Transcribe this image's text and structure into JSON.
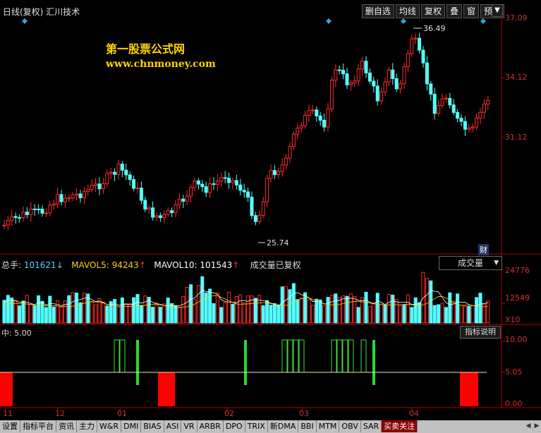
{
  "window": {
    "title": "日线(复权) 汇川技术"
  },
  "toolbar": {
    "buttons": [
      "删自选",
      "均线",
      "复权",
      "叠",
      "窗",
      "预测"
    ]
  },
  "price_axis": {
    "labels": [
      "37.09",
      "34.12",
      "31.12"
    ]
  },
  "annotations": {
    "high": "36.49",
    "low": "25.74",
    "badge": "财"
  },
  "watermark": {
    "line1": "第一股票公式网",
    "line2": "www.chnmoney.com"
  },
  "volume_header": {
    "total_label": "总手:",
    "total_value": "101621",
    "mavol5_label": "MAVOL5:",
    "mavol5_value": "94243",
    "mavol10_label": "MAVOL10:",
    "mavol10_value": "101543",
    "note": "成交量已复权",
    "dropdown": "成交量"
  },
  "volume_axis": {
    "labels": [
      "24776",
      "12549",
      "X10"
    ]
  },
  "indicator": {
    "header": "中: 5.00",
    "explain_button": "指标说明",
    "axis": [
      "10.00",
      "5.05",
      "0.00"
    ]
  },
  "date_axis": {
    "labels": [
      "11",
      "12",
      "01",
      "02",
      "03",
      "04"
    ]
  },
  "tabs": [
    "设置",
    "指标平台",
    "资讯",
    "主力",
    "W&R",
    "DMI",
    "BIAS",
    "ASI",
    "VR",
    "ARBR",
    "DPO",
    "TRIX",
    "新DMA",
    "BBI",
    "MTM",
    "OBV",
    "SAR",
    "买卖关注"
  ],
  "active_tab_index": 17,
  "colors": {
    "up": "#ff2a2a",
    "down": "#54ffff",
    "axis": "#b00000",
    "accent": "#ffd400"
  }
}
